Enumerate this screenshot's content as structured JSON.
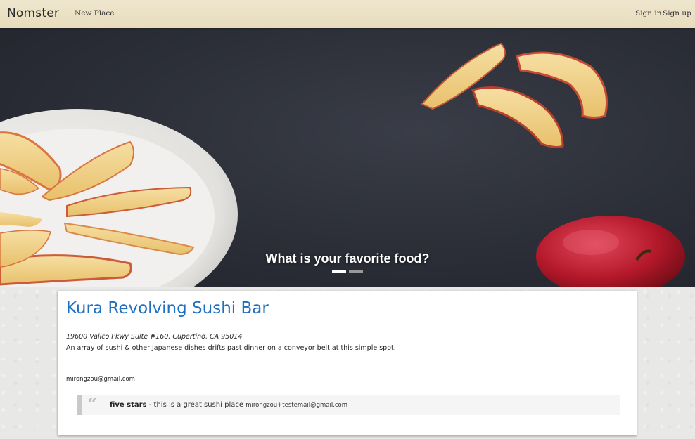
{
  "navbar": {
    "brand": "Nomster",
    "new_place": "New Place",
    "sign_in": "Sign in",
    "sign_up": "Sign up"
  },
  "hero": {
    "caption": "What is your favorite food?",
    "slide_count": 2,
    "active_slide": 1
  },
  "place": {
    "name": "Kura Revolving Sushi Bar",
    "address": "19600 Vallco Pkwy Suite #160, Cupertino, CA 95014",
    "description": "An array of sushi & other Japanese dishes drifts past dinner on a conveyor belt at this simple spot.",
    "owner_email": "mirongzou@gmail.com"
  },
  "comments": [
    {
      "rating": "five stars",
      "separator": " - ",
      "message": "this is a great sushi place",
      "email": "mirongzou+testemail@gmail.com"
    }
  ],
  "colors": {
    "link_blue": "#1f6fc0",
    "navbar_bg": "#eae0c4",
    "hero_bg": "#2b2e37"
  }
}
